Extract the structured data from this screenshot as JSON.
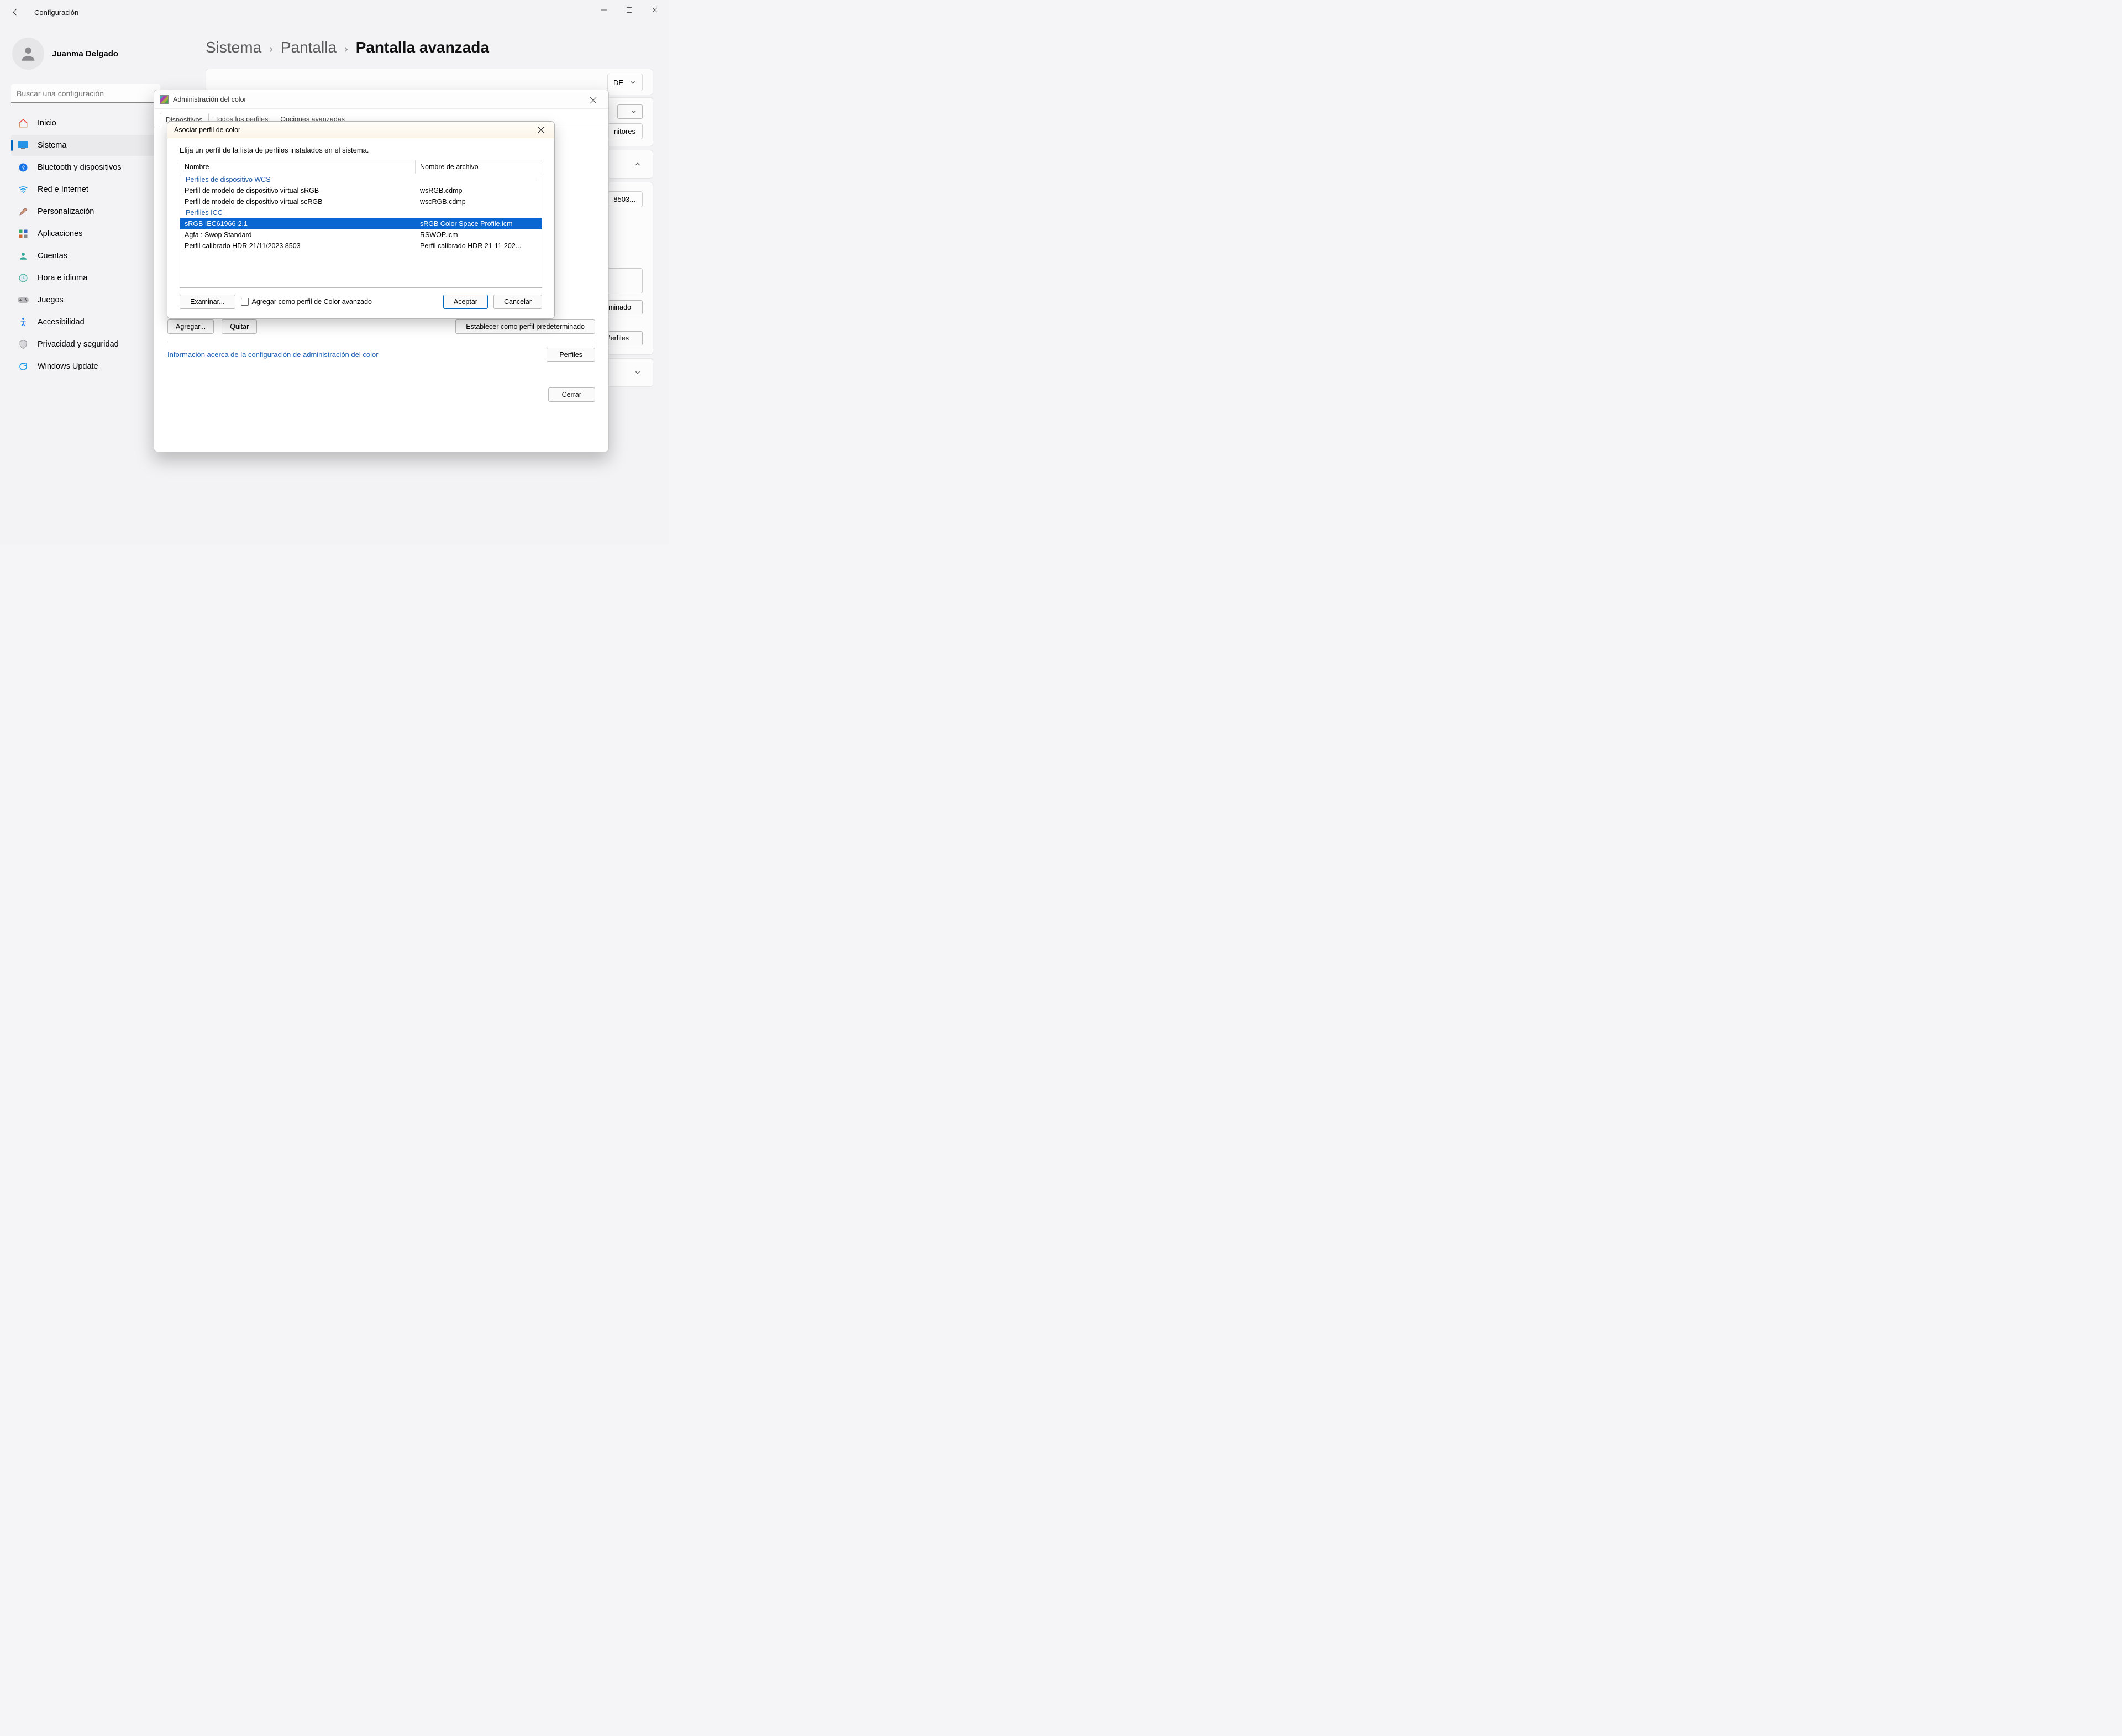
{
  "window": {
    "title": "Configuración",
    "user_name": "Juanma Delgado",
    "search_placeholder": "Buscar una configuración"
  },
  "nav": [
    {
      "id": "inicio",
      "label": "Inicio"
    },
    {
      "id": "sistema",
      "label": "Sistema"
    },
    {
      "id": "bluetooth",
      "label": "Bluetooth y dispositivos"
    },
    {
      "id": "red",
      "label": "Red e Internet"
    },
    {
      "id": "personalizacion",
      "label": "Personalización"
    },
    {
      "id": "aplicaciones",
      "label": "Aplicaciones"
    },
    {
      "id": "cuentas",
      "label": "Cuentas"
    },
    {
      "id": "hora",
      "label": "Hora e idioma"
    },
    {
      "id": "juegos",
      "label": "Juegos"
    },
    {
      "id": "accesibilidad",
      "label": "Accesibilidad"
    },
    {
      "id": "privacidad",
      "label": "Privacidad y seguridad"
    },
    {
      "id": "update",
      "label": "Windows Update"
    }
  ],
  "breadcrumb": {
    "a": "Sistema",
    "b": "Pantalla",
    "current": "Pantalla avanzada"
  },
  "main": {
    "topdrop_suffix": "DE",
    "identify": "nitores",
    "profile_stub": "8503...",
    "add": "Agregar...",
    "remove": "Quitar",
    "set_default": "Establecer como perfil predeterminado",
    "profiles_btn": "Perfiles"
  },
  "cm": {
    "title": "Administración del color",
    "tabs": {
      "devices": "Dispositivos",
      "all": "Todos los perfiles",
      "advanced": "Opciones avanzadas"
    },
    "info_link": "Información acerca de la configuración de administración del color",
    "close": "Cerrar"
  },
  "assoc": {
    "title": "Asociar perfil de color",
    "instr": "Elija un perfil de la lista de perfiles instalados en el sistema.",
    "col_name": "Nombre",
    "col_file": "Nombre de archivo",
    "group_wcs": "Perfiles de dispositivo WCS",
    "group_icc": "Perfiles ICC",
    "rows_wcs": [
      {
        "name": "Perfil de modelo de dispositivo virtual sRGB",
        "file": "wsRGB.cdmp"
      },
      {
        "name": "Perfil de modelo de dispositivo virtual scRGB",
        "file": "wscRGB.cdmp"
      }
    ],
    "rows_icc": [
      {
        "name": "sRGB IEC61966-2.1",
        "file": "sRGB Color Space Profile.icm",
        "selected": true
      },
      {
        "name": "Agfa : Swop Standard",
        "file": "RSWOP.icm"
      },
      {
        "name": "Perfil calibrado HDR 21/11/2023 8503",
        "file": "Perfil calibrado HDR 21-11-202..."
      }
    ],
    "browse": "Examinar...",
    "adv_check": "Agregar como perfil de Color avanzado",
    "accept": "Aceptar",
    "cancel": "Cancelar"
  }
}
